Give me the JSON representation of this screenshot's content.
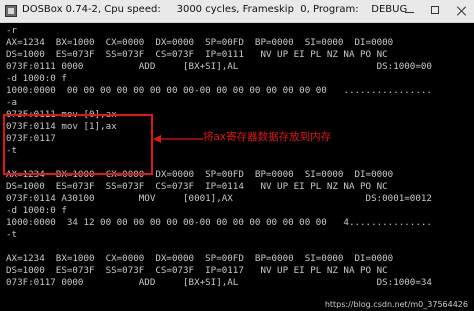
{
  "window": {
    "title": "DOSBox 0.74-2, Cpu speed:     3000 cycles, Frameskip  0, Program:    DEBUG"
  },
  "lines": [
    "-r",
    "AX=1234  BX=1000  CX=0000  DX=0000  SP=00FD  BP=0000  SI=0000  DI=0000",
    "DS=1000  ES=073F  SS=073F  CS=073F  IP=0111   NV UP EI PL NZ NA PO NC",
    "073F:0111 0000          ADD     [BX+SI],AL                         DS:1000=00",
    "-d 1000:0 f",
    "1000:0000  00 00 00 00 00 00 00 00-00 00 00 00 00 00 00 00   ................",
    "-a",
    "073F:0111 mov [0],ax",
    "073F:0114 mov [1],ax",
    "073F:0117",
    "-t",
    "",
    "AX=1234  BX=1000  CX=0000  DX=0000  SP=00FD  BP=0000  SI=0000  DI=0000",
    "DS=1000  ES=073F  SS=073F  CS=073F  IP=0114   NV UP EI PL NZ NA PO NC",
    "073F:0114 A30100        MOV     [0001],AX                        DS:0001=0012",
    "-d 1000:0 f",
    "1000:0000  34 12 00 00 00 00 00 00-00 00 00 00 00 00 00 00   4...............",
    "-t",
    "",
    "AX=1234  BX=1000  CX=0000  DX=0000  SP=00FD  BP=0000  SI=0000  DI=0000",
    "DS=1000  ES=073F  SS=073F  CS=073F  IP=0117   NV UP EI PL NZ NA PO NC",
    "073F:0117 0000          ADD     [BX+SI],AL                         DS:1000=34"
  ],
  "annotation": {
    "text": "将ax寄存器数据存放到内存",
    "color": "#e01515"
  },
  "watermark": {
    "text": "https://blog.csdn.net/m0_37564426"
  }
}
